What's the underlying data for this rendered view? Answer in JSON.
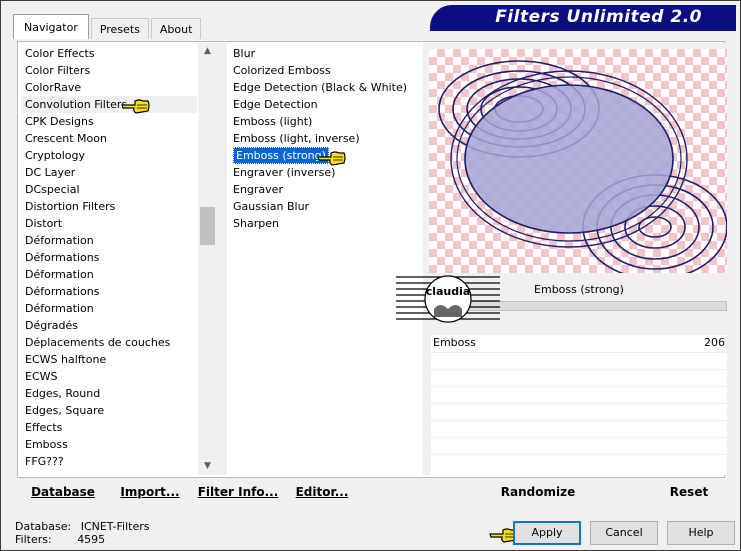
{
  "banner": {
    "title": "Filters Unlimited 2.0"
  },
  "tabs": [
    {
      "label": "Navigator",
      "active": true
    },
    {
      "label": "Presets",
      "active": false
    },
    {
      "label": "About",
      "active": false
    }
  ],
  "categories": [
    "Color Effects",
    "Color Filters",
    "ColorRave",
    "Convolution Filters",
    "CPK Designs",
    "Crescent Moon",
    "Cryptology",
    "DC Layer",
    "DCspecial",
    "Distortion Filters",
    "Distort",
    "Déformation",
    "Déformations",
    "Déformation",
    "Déformations",
    "Déformation",
    "Dégradés",
    "Déplacements de couches",
    "ECWS halftone",
    "ECWS",
    "Edges, Round",
    "Edges, Square",
    "Effects",
    "Emboss",
    "FFG???"
  ],
  "selected_category": "Convolution Filters",
  "filters": [
    "Blur",
    "Colorized Emboss",
    "Edge Detection (Black & White)",
    "Edge Detection",
    "Emboss (light)",
    "Emboss (light, inverse)",
    "Emboss (strong)",
    "Engraver (inverse)",
    "Engraver",
    "Gaussian Blur",
    "Sharpen"
  ],
  "selected_filter": "Emboss (strong)",
  "filter_name_display": "Emboss (strong)",
  "params": [
    {
      "label": "Emboss",
      "value": "206"
    }
  ],
  "stamp_text": "claudia",
  "bottom_links": {
    "database": "Database",
    "import": "Import...",
    "filter_info": "Filter Info...",
    "editor": "Editor...",
    "randomize": "Randomize",
    "reset": "Reset"
  },
  "status": {
    "database_label": "Database:",
    "database_value": "ICNET-Filters",
    "filters_label": "Filters:",
    "filters_value": "4595"
  },
  "buttons": {
    "apply": "Apply",
    "cancel": "Cancel",
    "help": "Help"
  },
  "colors": {
    "banner": "#0b0d80",
    "selection": "#0a64d6",
    "preview_ellipse": "#a3a6d6",
    "checker": "#f6c4c8"
  }
}
